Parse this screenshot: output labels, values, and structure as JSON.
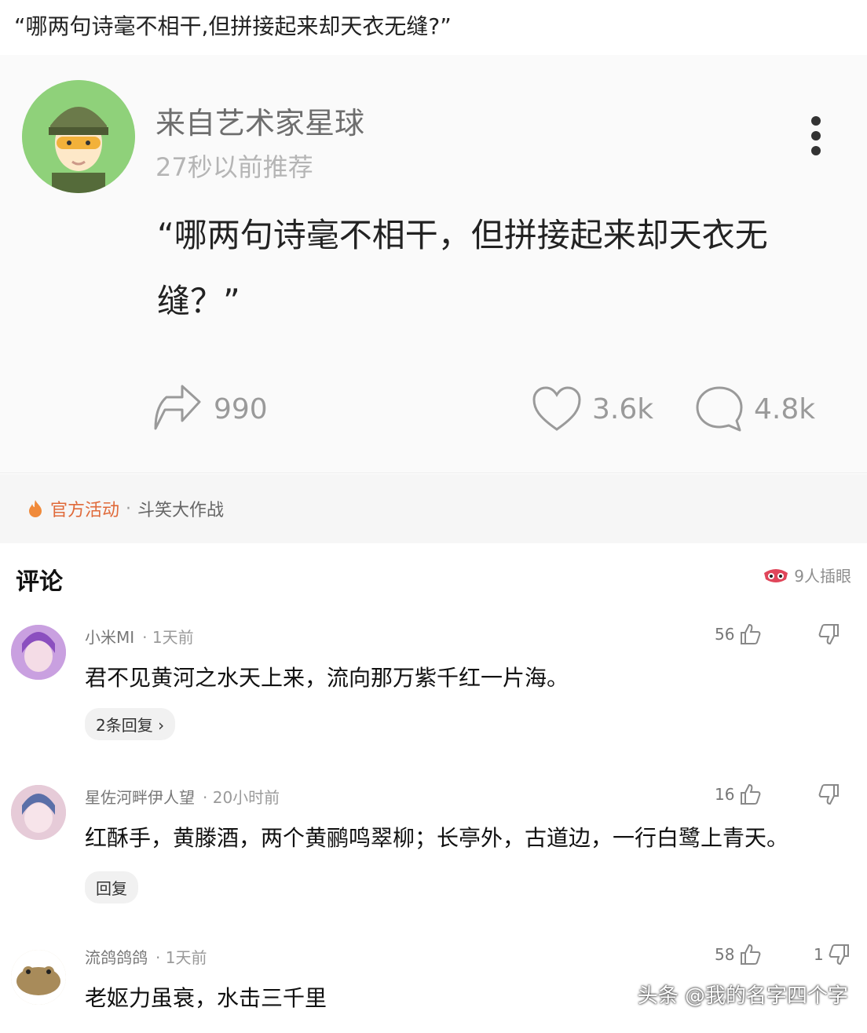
{
  "page_title": "“哪两句诗毫不相干,但拼接起来却天衣无缝?”",
  "post": {
    "author": "来自艺术家星球",
    "time": "27秒以前推荐",
    "text_line1": "“哪两句诗毫不相干，但拼接起来却天衣无",
    "text_line2": "缝？”",
    "shares": "990",
    "likes": "3.6k",
    "comments": "4.8k"
  },
  "activity": {
    "label": "官方活动",
    "separator": "·",
    "event": "斗笑大作战"
  },
  "comments_section": {
    "heading": "评论",
    "peek_text": "9人插眼"
  },
  "comments": [
    {
      "user": "小米MI",
      "time": "· 1天前",
      "text": "君不见黄河之水天上来，流向那万紫千红一片海。",
      "replies": "2条回复 ›",
      "likes": "56",
      "dislikes": ""
    },
    {
      "user": "星佐河畔伊人望",
      "time": "· 20小时前",
      "text": "红酥手，黄滕酒，两个黄鹂鸣翠柳；长亭外，古道边，一行白鹭上青天。",
      "replies": "回复",
      "likes": "16",
      "dislikes": ""
    },
    {
      "user": "流鸽鸽鸽",
      "time": "· 1天前",
      "text": "老妪力虽衰，水击三千里",
      "likes": "58",
      "dislikes": "1"
    }
  ],
  "watermark": "头条 @我的名字四个字",
  "colors": {
    "accent_orange": "#e06a3a",
    "muted_gray": "#9a9a9a",
    "avatar_green": "#8fd17a"
  }
}
